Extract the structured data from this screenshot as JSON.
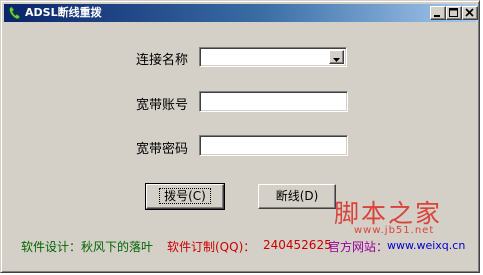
{
  "window": {
    "title": "ADSL断线重拨",
    "icon": "phone-icon",
    "controls": [
      "minimize-icon",
      "maximize-icon",
      "close-icon"
    ]
  },
  "form": {
    "connection_label": "连接名称",
    "connection_value": "",
    "account_label": "宽带账号",
    "account_value": "",
    "password_label": "宽带密码",
    "password_value": ""
  },
  "buttons": {
    "dial": "拨号(C)",
    "disconnect": "断线(D)"
  },
  "footer": {
    "author": "软件设计：秋风下的落叶",
    "custom_label": "软件订制(QQ)：",
    "custom_qq": "240452625",
    "site_label": "官方网站：",
    "site_url": "www.weixq.cn"
  },
  "watermark": {
    "text": "脚本之家",
    "url": "www.jb51.net"
  },
  "colors": {
    "footer_author": "#006600",
    "footer_custom": "#cc0000",
    "footer_qq": "#cc0000",
    "footer_site_label": "#990099",
    "footer_site_url": "#0000cc",
    "watermark": "#d9433a"
  }
}
